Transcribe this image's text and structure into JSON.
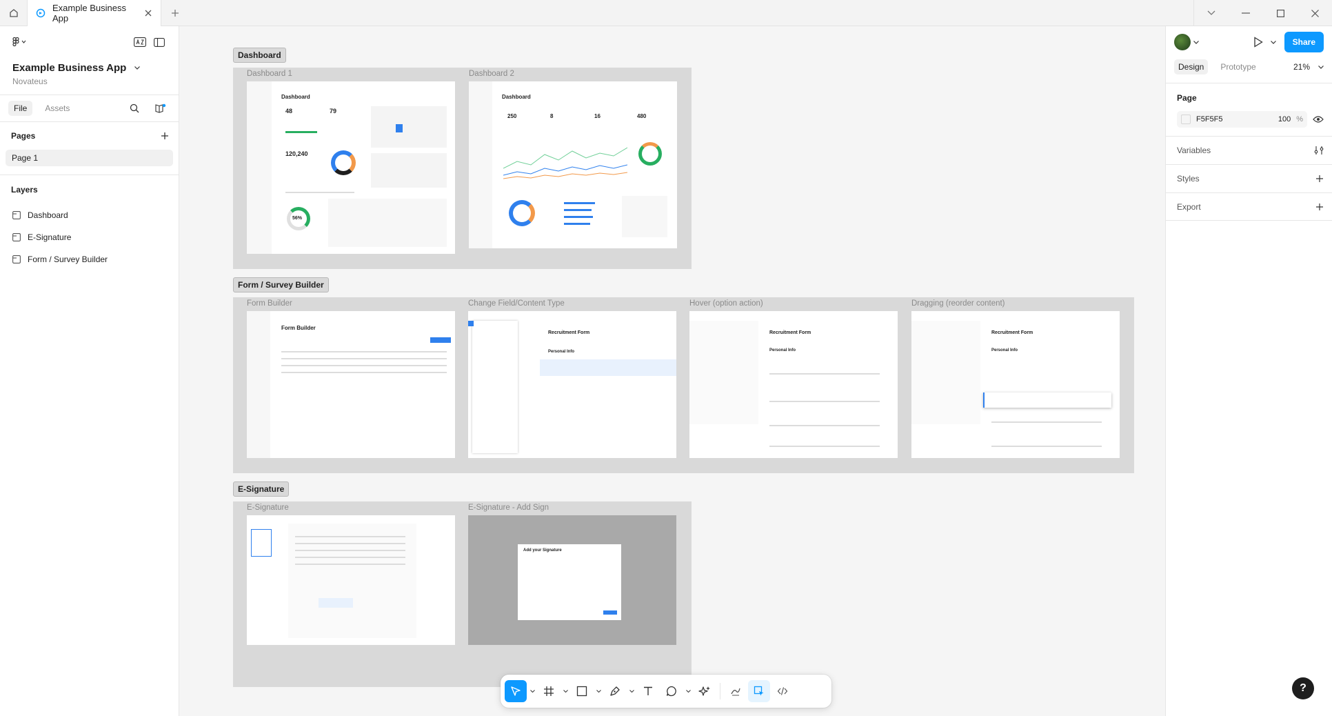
{
  "tab": {
    "title": "Example Business App"
  },
  "left": {
    "file_name": "Example Business App",
    "team": "Novateus",
    "tabs": [
      "File",
      "Assets"
    ],
    "pages_heading": "Pages",
    "pages": [
      "Page 1"
    ],
    "layers_heading": "Layers",
    "layers": [
      "Dashboard",
      "E-Signature",
      "Form / Survey Builder"
    ]
  },
  "canvas": {
    "sections": {
      "dashboard": "Dashboard",
      "form": "Form / Survey Builder",
      "esign": "E-Signature"
    },
    "frames": {
      "dashboard1": "Dashboard 1",
      "dashboard2": "Dashboard 2",
      "form_builder": "Form Builder",
      "change_field": "Change Field/Content Type",
      "hover": "Hover (option action)",
      "dragging": "Dragging (reorder content)",
      "esign": "E-Signature",
      "esign_add": "E-Signature - Add Sign"
    },
    "frame_titles": {
      "dashboard1": "Dashboard",
      "dashboard2": "Dashboard",
      "d1_num1": "48",
      "d1_num2": "79",
      "d1_num3": "120,240",
      "d1_pct": "56%",
      "d2_num1": "250",
      "d2_num2": "8",
      "d2_num3": "16",
      "d2_num4": "480",
      "form_builder": "Form Builder",
      "recruit": "Recruitment Form",
      "personal_info": "Personal Info",
      "add_sign": "Add your Signature"
    }
  },
  "right": {
    "tabs": [
      "Design",
      "Prototype"
    ],
    "zoom": "21%",
    "share": "Share",
    "page_heading": "Page",
    "fill_hex": "F5F5F5",
    "fill_opacity": "100",
    "pct": "%",
    "sections": [
      "Variables",
      "Styles",
      "Export"
    ]
  },
  "help": "?",
  "colors": {
    "accent": "#0d99ff",
    "canvas": "#f5f5f5",
    "section": "#d9d9d9"
  }
}
